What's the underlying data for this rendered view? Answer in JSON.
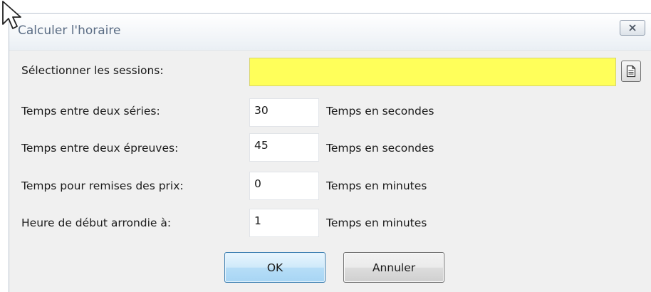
{
  "dialog": {
    "title": "Calculer l'horaire",
    "close_icon": "close-icon"
  },
  "form": {
    "sessions": {
      "label": "Sélectionner les sessions:",
      "value": "",
      "highlight_color": "#ffff5a",
      "browse_icon": "document-icon"
    },
    "rows": [
      {
        "label": "Temps entre deux séries:",
        "value": "30",
        "hint": "Temps en secondes"
      },
      {
        "label": "Temps entre deux épreuves:",
        "value": "45",
        "hint": "Temps en secondes"
      },
      {
        "label": "Temps pour remises des prix:",
        "value": "0",
        "hint": "Temps en minutes"
      },
      {
        "label": "Heure de début arrondie à:",
        "value": "1",
        "hint": "Temps en minutes"
      }
    ]
  },
  "buttons": {
    "ok_label": "OK",
    "cancel_label": "Annuler"
  },
  "pointer": "mouse-cursor-icon"
}
